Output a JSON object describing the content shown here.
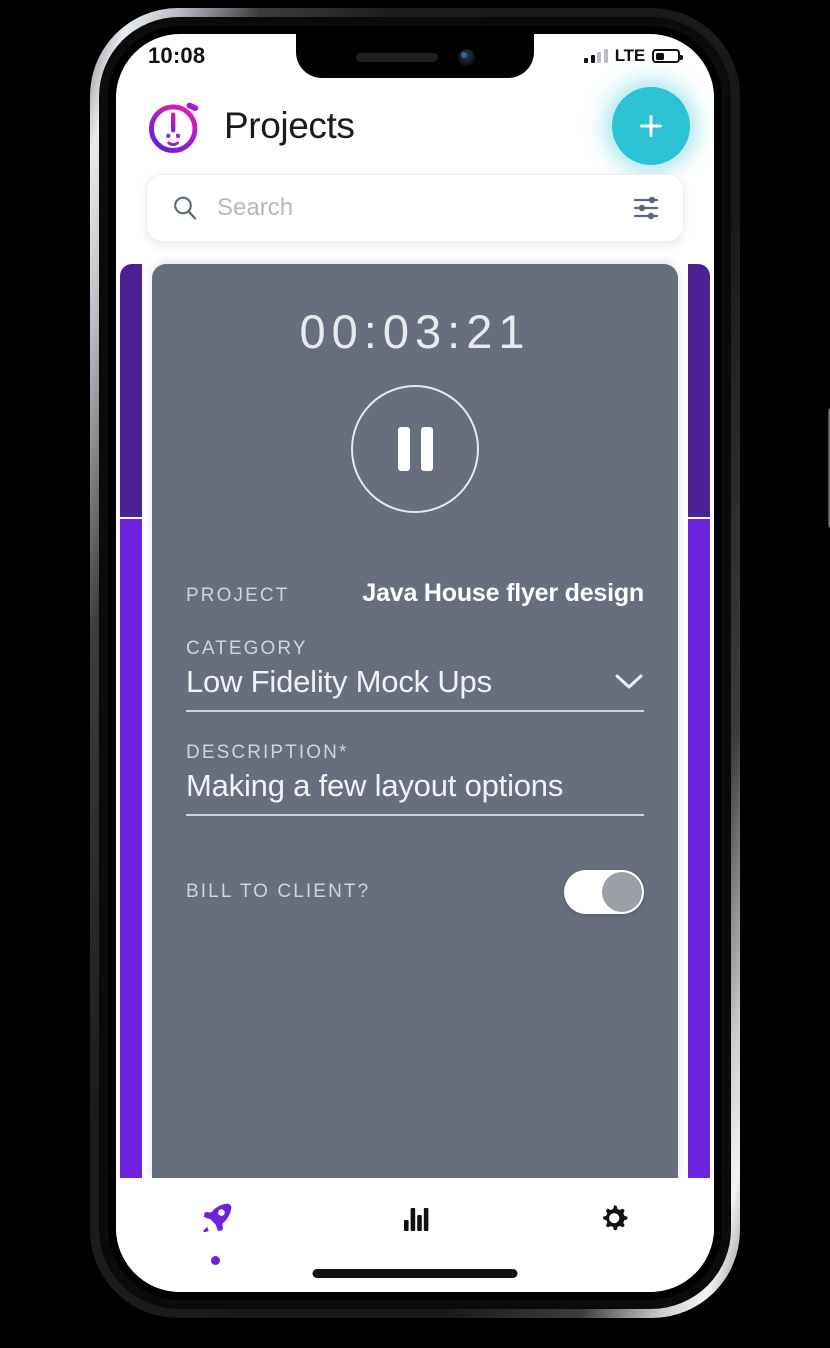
{
  "status_bar": {
    "time": "10:08",
    "network_label": "LTE",
    "signal_bars_filled": 2,
    "signal_bars_total": 4,
    "battery_percent": 42,
    "icons": [
      "signal-icon",
      "lte-label",
      "battery-icon"
    ]
  },
  "header": {
    "title": "Projects",
    "logo_icon": "stopwatch-face-logo",
    "logo_gradient_from": "#d61fb0",
    "logo_gradient_to": "#6a1fd6",
    "add_button": {
      "icon": "plus-icon",
      "color": "#2ac2d4",
      "label": "+"
    }
  },
  "search": {
    "placeholder": "Search",
    "value": "",
    "search_icon": "search-icon",
    "filter_icon": "filter-sliders-icon"
  },
  "carousel": {
    "peek_card_color_top": "#4b2193",
    "peek_card_color_bottom": "#6c22df",
    "active_card_color": "#676e7d"
  },
  "timer_card": {
    "elapsed": "00:03:21",
    "control_icon": "pause-icon",
    "control_state": "running",
    "fields": {
      "project": {
        "label": "PROJECT",
        "value": "Java House flyer design"
      },
      "category": {
        "label": "CATEGORY",
        "value": "Low Fidelity Mock Ups",
        "icon": "chevron-down-icon"
      },
      "description": {
        "label": "DESCRIPTION*",
        "value": "Making a few layout options"
      },
      "bill_to_client": {
        "label": "BILL TO CLIENT?",
        "value": "on",
        "icon": "toggle-switch-icon"
      }
    }
  },
  "tabbar": {
    "items": [
      {
        "name": "projects",
        "icon": "rocket-icon",
        "active": true,
        "color": "#6c22df"
      },
      {
        "name": "reports",
        "icon": "bar-chart-icon",
        "active": false,
        "color": "#111111"
      },
      {
        "name": "settings",
        "icon": "gear-icon",
        "active": false,
        "color": "#111111"
      }
    ]
  },
  "home_indicator": "home-indicator-bar"
}
